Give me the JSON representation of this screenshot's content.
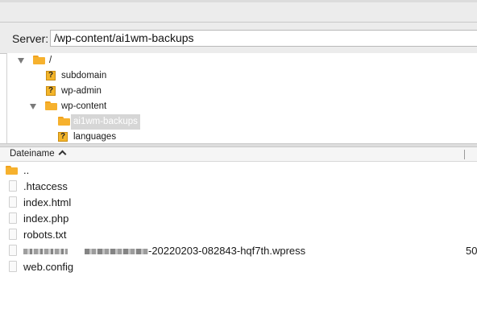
{
  "server": {
    "label": "Server:",
    "path": "/wp-content/ai1wm-backups"
  },
  "tree": {
    "items": [
      {
        "label": "/",
        "icon": "folder-icon",
        "expanded": true
      },
      {
        "label": "subdomain",
        "icon": "question-icon"
      },
      {
        "label": "wp-admin",
        "icon": "question-icon"
      },
      {
        "label": "wp-content",
        "icon": "folder-icon",
        "expanded": true
      },
      {
        "label": "ai1wm-backups",
        "icon": "folder-icon",
        "selected": true
      },
      {
        "label": "languages",
        "icon": "question-icon"
      }
    ]
  },
  "list": {
    "column_name": "Dateiname",
    "files": [
      {
        "name": "..",
        "icon": "folder-icon"
      },
      {
        "name": ".htaccess",
        "icon": "document-icon"
      },
      {
        "name": "index.html",
        "icon": "document-icon"
      },
      {
        "name": "index.php",
        "icon": "document-icon"
      },
      {
        "name": "robots.txt",
        "icon": "document-icon"
      },
      {
        "name_suffix": "-20220203-082843-hqf7th.wpress",
        "size": "50",
        "icon": "document-icon",
        "redacted_prefix": true
      },
      {
        "name": "web.config",
        "icon": "document-icon"
      }
    ]
  }
}
